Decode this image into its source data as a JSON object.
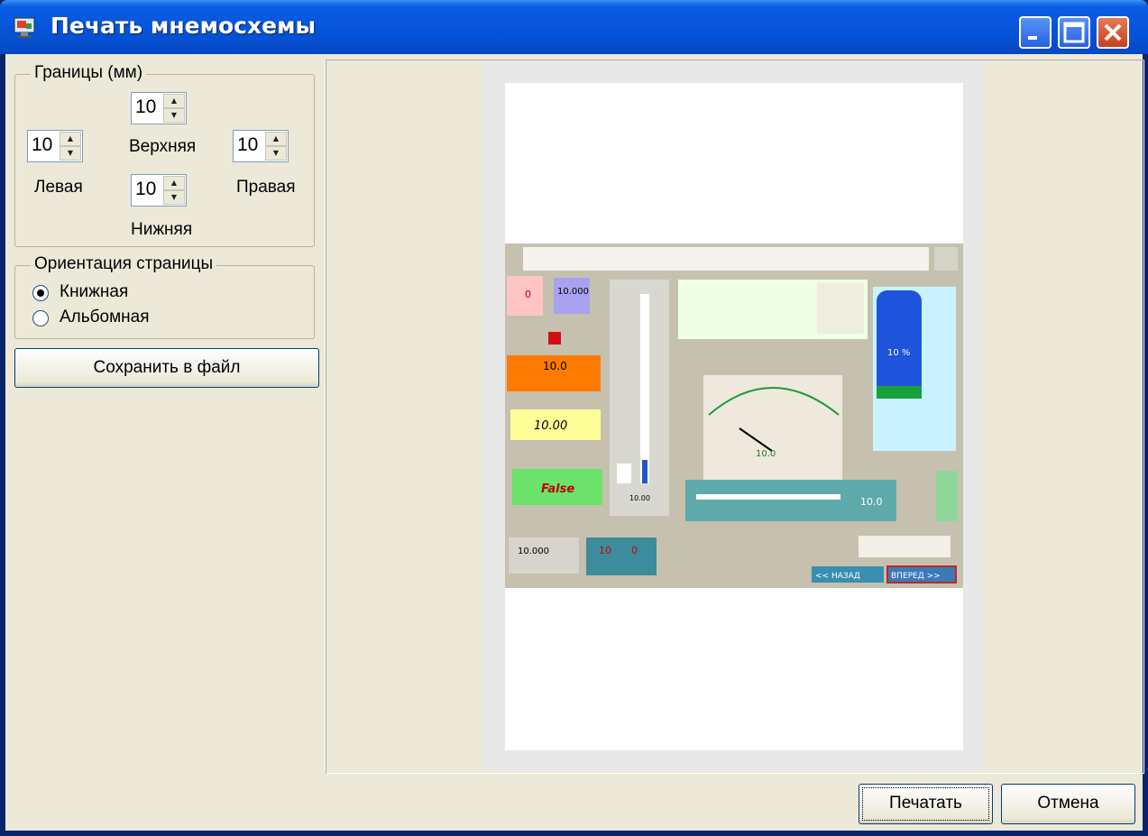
{
  "window": {
    "title": "Печать мнемосхемы"
  },
  "margins": {
    "group_title": "Границы (мм)",
    "top": {
      "value": "10",
      "label": "Верхняя"
    },
    "left": {
      "value": "10",
      "label": "Левая"
    },
    "right": {
      "value": "10",
      "label": "Правая"
    },
    "bottom": {
      "value": "10",
      "label": "Нижняя"
    }
  },
  "orientation": {
    "group_title": "Ориентация страницы",
    "options": [
      {
        "label": "Книжная",
        "selected": true
      },
      {
        "label": "Альбомная",
        "selected": false
      }
    ]
  },
  "save_button": "Сохранить в файл",
  "preview": {
    "readouts": {
      "red_box": "0",
      "blue_box": "10.000",
      "orange_box": "10.0",
      "yellow_box": "10.00",
      "green_box": "False",
      "gray_box": "10.000",
      "teal_left": "10",
      "teal_right": "0",
      "slider_value": "10.0",
      "tank_percent": "10 %",
      "gauge_value": "10.0",
      "vertical_scale_value": "10.00"
    },
    "nav": {
      "back": "<< НАЗАД",
      "forward": "ВПЕРЕД >>"
    }
  },
  "buttons": {
    "print": "Печатать",
    "cancel": "Отмена"
  },
  "colors": {
    "title_bar": "#0553d8",
    "client_bg": "#ece9d8"
  }
}
